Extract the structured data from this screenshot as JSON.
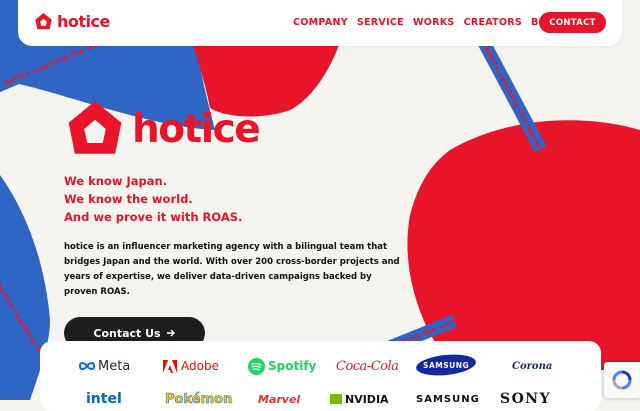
{
  "header": {
    "brand": "hotice",
    "nav": [
      "COMPANY",
      "SERVICE",
      "WORKS",
      "CREATORS",
      "BLOG"
    ],
    "contact_label": "CONTACT"
  },
  "hero": {
    "brand": "hotice",
    "tagline": [
      "We know Japan.",
      "We know the world.",
      "And we prove it with ROAS."
    ],
    "description": "hotice is an influencer marketing agency with a bilingual team that bridges Japan and the world. With over 200 cross-border projects and years of expertise, we deliver data-driven campaigns backed by proven ROAS.",
    "cta_label": "Contact Us"
  },
  "client_logos": {
    "row1": [
      "Meta",
      "Adobe",
      "Spotify",
      "Coca-Cola",
      "SAMSUNG",
      "Corona"
    ],
    "row2": [
      "intel",
      "Pokémon",
      "Marvel",
      "NVIDIA",
      "SAMSUNG",
      "SONY"
    ]
  },
  "tapes": [
    "hotice reaching the world",
    "hotice reaching the world",
    "hotice reaching the world",
    "hotice reaching the world"
  ],
  "colors": {
    "brand_red": "#e8142a",
    "blue": "#2f66c6",
    "background": "#f6f4ee",
    "dark": "#1e1e1e"
  },
  "icons": [
    "hotice-house-icon",
    "arrow-right-icon",
    "recaptcha-icon"
  ]
}
